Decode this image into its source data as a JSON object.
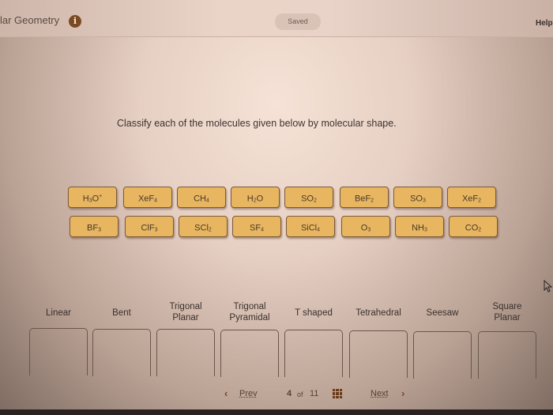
{
  "header": {
    "title": "lar Geometry",
    "info_icon": "info-icon",
    "saved_label": "Saved",
    "help_label": "Help"
  },
  "prompt": "Classify each of the molecules given below by molecular shape.",
  "molecules": [
    {
      "base": "H",
      "sub1": "3",
      "mid": "O",
      "sub2": "",
      "sup": "+"
    },
    {
      "base": "XeF",
      "sub1": "4",
      "mid": "",
      "sub2": "",
      "sup": ""
    },
    {
      "base": "CH",
      "sub1": "4",
      "mid": "",
      "sub2": "",
      "sup": ""
    },
    {
      "base": "H",
      "sub1": "2",
      "mid": "O",
      "sub2": "",
      "sup": ""
    },
    {
      "base": "SO",
      "sub1": "2",
      "mid": "",
      "sub2": "",
      "sup": ""
    },
    {
      "base": "BeF",
      "sub1": "2",
      "mid": "",
      "sub2": "",
      "sup": ""
    },
    {
      "base": "SO",
      "sub1": "3",
      "mid": "",
      "sub2": "",
      "sup": ""
    },
    {
      "base": "XeF",
      "sub1": "2",
      "mid": "",
      "sub2": "",
      "sup": ""
    },
    {
      "base": "BF",
      "sub1": "3",
      "mid": "",
      "sub2": "",
      "sup": ""
    },
    {
      "base": "ClF",
      "sub1": "3",
      "mid": "",
      "sub2": "",
      "sup": ""
    },
    {
      "base": "SCl",
      "sub1": "2",
      "mid": "",
      "sub2": "",
      "sup": ""
    },
    {
      "base": "SF",
      "sub1": "4",
      "mid": "",
      "sub2": "",
      "sup": ""
    },
    {
      "base": "SiCl",
      "sub1": "4",
      "mid": "",
      "sub2": "",
      "sup": ""
    },
    {
      "base": "O",
      "sub1": "3",
      "mid": "",
      "sub2": "",
      "sup": ""
    },
    {
      "base": "NH",
      "sub1": "3",
      "mid": "",
      "sub2": "",
      "sup": ""
    },
    {
      "base": "CO",
      "sub1": "2",
      "mid": "",
      "sub2": "",
      "sup": ""
    }
  ],
  "bins": [
    {
      "line1": "Linear",
      "line2": ""
    },
    {
      "line1": "Bent",
      "line2": ""
    },
    {
      "line1": "Trigonal",
      "line2": "Planar"
    },
    {
      "line1": "Trigonal",
      "line2": "Pyramidal"
    },
    {
      "line1": "T shaped",
      "line2": ""
    },
    {
      "line1": "Tetrahedral",
      "line2": ""
    },
    {
      "line1": "Seesaw",
      "line2": ""
    },
    {
      "line1": "Square",
      "line2": "Planar"
    }
  ],
  "pager": {
    "prev_label": "Prev",
    "current": "4",
    "of_label": "of",
    "total": "11",
    "next_label": "Next",
    "prev_icon": "chevron-left-icon",
    "next_icon": "chevron-right-icon",
    "grid_icon": "grid-icon"
  },
  "colors": {
    "tile_fill": "#e8b661",
    "tile_border": "#7a5a3a",
    "accent_brown": "#7a4a22"
  }
}
